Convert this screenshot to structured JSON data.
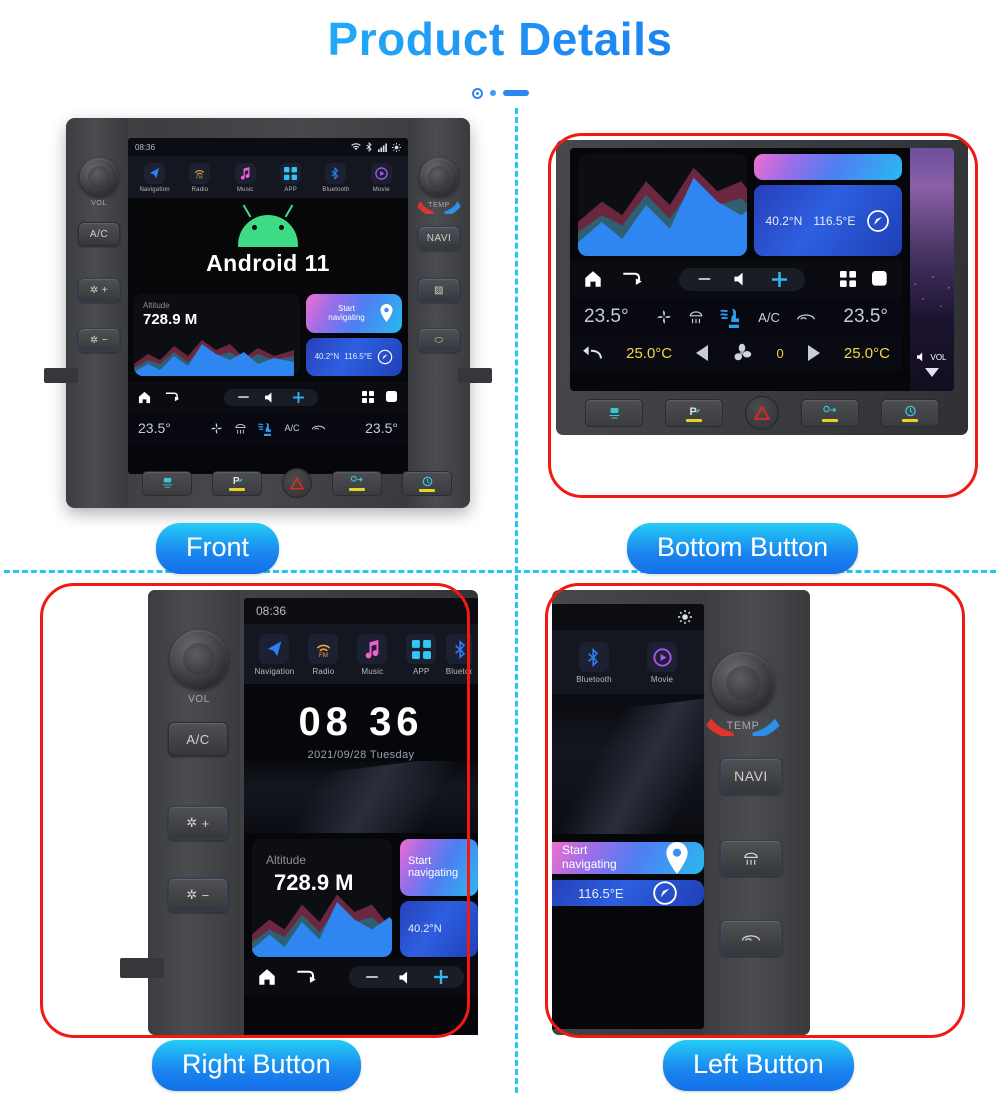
{
  "header": {
    "title": "Product Details"
  },
  "panels": {
    "front": {
      "caption": "Front"
    },
    "bottom": {
      "caption": "Bottom Button"
    },
    "right": {
      "caption": "Right Button"
    },
    "left": {
      "caption": "Left Button"
    }
  },
  "screen": {
    "status": {
      "time": "08:36",
      "icons": [
        "wifi-icon",
        "bluetooth-icon",
        "signal-icon",
        "brightness-icon"
      ]
    },
    "apps": [
      {
        "label": "Navigation",
        "icon": "navigation-arrow-icon"
      },
      {
        "label": "Radio",
        "icon": "radio-fm-icon"
      },
      {
        "label": "Music",
        "icon": "music-note-icon"
      },
      {
        "label": "APP",
        "icon": "app-grid-icon"
      },
      {
        "label": "Bluetooth",
        "icon": "bluetooth-icon"
      },
      {
        "label": "Movie",
        "icon": "movie-play-icon"
      }
    ],
    "android": {
      "label": "Android 11"
    },
    "altitude": {
      "label": "Altitude",
      "value": "728.9 M"
    },
    "navigate_card": {
      "line1": "Start",
      "line2": "navigating",
      "icon": "location-pin-icon"
    },
    "coordinates": {
      "lat": "40.2°N",
      "lon": "116.5°E",
      "icon": "compass-icon"
    },
    "navbar": {
      "home": "home-icon",
      "back": "return-arrow-icon",
      "volume_down": "minus-icon",
      "volume_icon": "speaker-icon",
      "volume_up": "plus-icon",
      "apps": "grid-icon",
      "recents": "square-icon"
    },
    "climate": {
      "temp_left": "23.5°",
      "temp_right": "23.5°",
      "ac_label": "A/C",
      "icons": [
        "fan-icon",
        "rear-defrost-icon",
        "airflow-seat-icon",
        "recirculate-icon"
      ]
    },
    "clock": {
      "hour": "08",
      "minute": "36",
      "date": "2021/09/28 Tuesday"
    }
  },
  "climate_panel": {
    "temp_left": "25.0°C",
    "temp_right": "25.0°C",
    "fan_level": "0",
    "fan_icon": "fan-blade-icon",
    "back_icon": "back-arrow-icon",
    "vol_label": "VOL"
  },
  "hard_buttons": [
    {
      "name": "traction-control-off-button",
      "icon": "car-traction-icon",
      "has_bar": false
    },
    {
      "name": "parking-sensor-button",
      "icon": "parking-p-icon",
      "has_bar": true
    },
    {
      "name": "hazard-button",
      "icon": "hazard-triangle-icon",
      "has_bar": false
    },
    {
      "name": "lane-assist-button",
      "icon": "lane-assist-icon",
      "has_bar": true
    },
    {
      "name": "auto-hold-button",
      "icon": "auto-hold-icon",
      "has_bar": true
    }
  ],
  "side_controls": {
    "left": {
      "knob_label": "VOL",
      "buttons": [
        {
          "label": "A/C",
          "name": "ac-button"
        },
        {
          "label": "+",
          "name": "fan-up-button",
          "icon": "fan-icon"
        },
        {
          "label": "−",
          "name": "fan-down-button",
          "icon": "fan-icon"
        }
      ]
    },
    "right": {
      "knob_label": "TEMP",
      "buttons": [
        {
          "label": "NAVI",
          "name": "navi-button"
        },
        {
          "label": "",
          "name": "rear-defrost-button",
          "icon": "defrost-icon"
        },
        {
          "label": "",
          "name": "trunk-release-button",
          "icon": "trunk-icon"
        }
      ]
    }
  },
  "colors": {
    "accent_cyan": "#23cdf5",
    "accent_blue": "#1470e8",
    "frame_red": "#f01a13",
    "android_green": "#3ddc84",
    "temp_yellow": "#f2d64a"
  }
}
